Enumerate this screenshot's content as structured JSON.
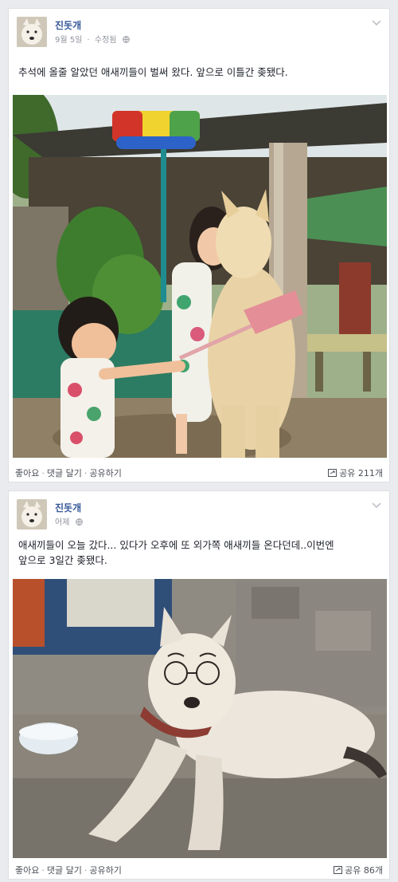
{
  "posts": [
    {
      "author": "진돗개",
      "date": "9월 5일",
      "edited": "수정됨",
      "text": "추석에 올줄 알았던 애새끼들이 벌써 왔다. 앞으로 이틀간 좆됐다.",
      "actions": {
        "like": "좋아요",
        "comment": "댓글 달기",
        "share": "공유하기"
      },
      "share_count": "공유 211개"
    },
    {
      "author": "진돗개",
      "date": "어제",
      "text_line1": "애새끼들이 오늘 갔다... 있다가 오후에 또 외가쪽 애새끼들 온다던데..이번엔",
      "text_line2": "앞으로 3일간 좆됐다.",
      "actions": {
        "like": "좋아요",
        "comment": "댓글 달기",
        "share": "공유하기"
      },
      "share_count": "공유 86개"
    }
  ],
  "icons": {
    "globe": "globe-icon",
    "chevron": "chevron-down-icon",
    "share": "share-icon"
  }
}
